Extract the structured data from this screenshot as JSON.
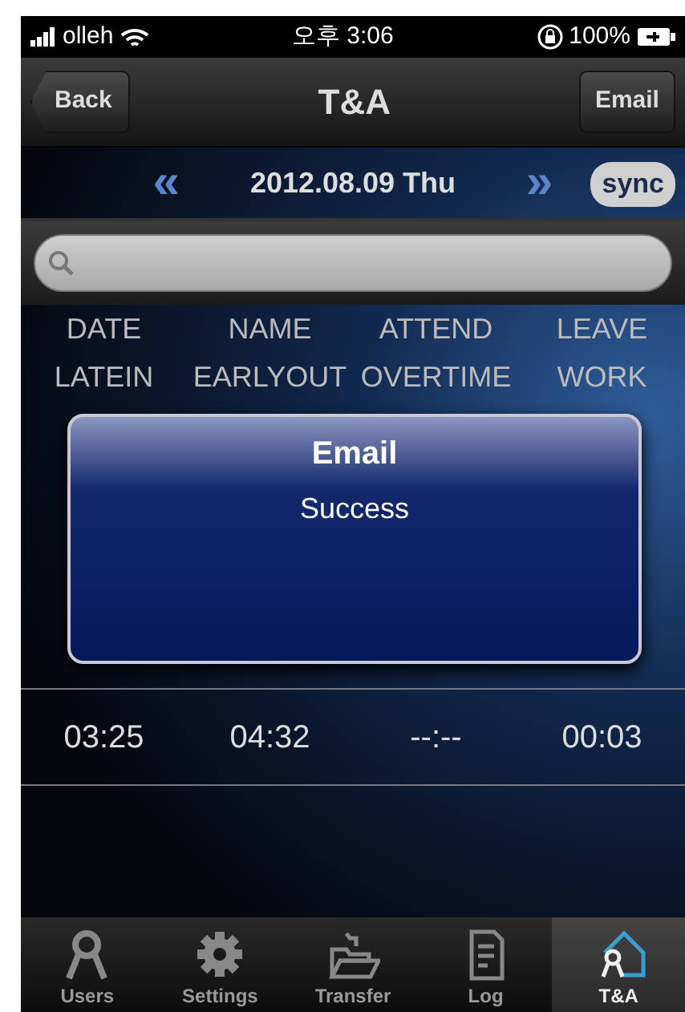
{
  "status_bar": {
    "carrier": "olleh",
    "time": "오후 3:06",
    "battery": "100%"
  },
  "nav_bar": {
    "back": "Back",
    "title": "T&A",
    "action": "Email"
  },
  "date_bar": {
    "prev": "«",
    "date": "2012.08.09 Thu",
    "next": "»",
    "sync": "sync"
  },
  "table": {
    "header_rows": [
      [
        "DATE",
        "NAME",
        "ATTEND",
        "LEAVE"
      ],
      [
        "LATEIN",
        "EARLYOUT",
        "OVERTIME",
        "WORK"
      ]
    ],
    "rows": [
      [
        "03:25",
        "04:32",
        "--:--",
        "00:03"
      ]
    ]
  },
  "alert": {
    "title": "Email",
    "message": "Success"
  },
  "tab_bar": [
    {
      "label": "Users",
      "selected": false
    },
    {
      "label": "Settings",
      "selected": false
    },
    {
      "label": "Transfer",
      "selected": false
    },
    {
      "label": "Log",
      "selected": false
    },
    {
      "label": "T&A",
      "selected": true
    }
  ]
}
